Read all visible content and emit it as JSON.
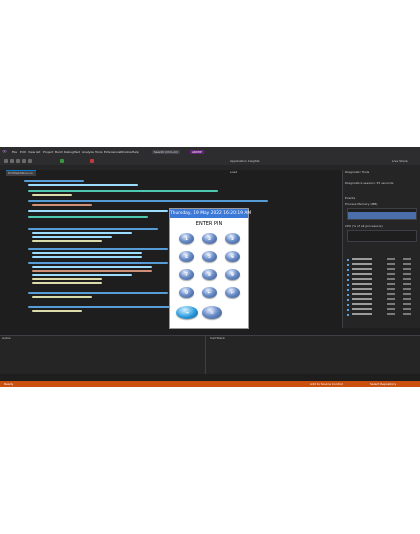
{
  "menubar": {
    "items": [
      "File",
      "Edit",
      "View",
      "Git",
      "Project",
      "Build",
      "Debug",
      "Test",
      "Analyze",
      "Tools",
      "Extensions",
      "Window",
      "Help"
    ],
    "search_label": "Search (Ctrl+Q)",
    "app_badge": "ADMIP"
  },
  "toolbar": {
    "run_label": "Application Insights",
    "live_share": "Live Share"
  },
  "editor": {
    "file_tab": "frmMainMenu.cs",
    "second_tab": "Load"
  },
  "pin_form": {
    "title": "Thursday, 19 May 2022 16:20:19 AM",
    "prompt": "ENTER PIN",
    "keys": [
      "1",
      "2",
      "3",
      "4",
      "5",
      "6",
      "7",
      "8",
      "9",
      "0",
      "←",
      "↵"
    ]
  },
  "diagnostics": {
    "title": "Diagnostic Tools",
    "session": "Diagnostics session: 35 seconds",
    "events_header": "Events",
    "memory_header": "Process Memory (MB)",
    "cpu_header": "CPU (% of all processors)"
  },
  "output": {
    "title": "Autos",
    "call_stack": "Call Stack"
  },
  "statusbar": {
    "ready": "Ready",
    "add_source": "Add to Source Control",
    "repo": "Select Repository"
  },
  "colors": {
    "ide_background": "#1e1e1e",
    "status_bar": "#ca5010",
    "form_title": "#3c78d8"
  }
}
